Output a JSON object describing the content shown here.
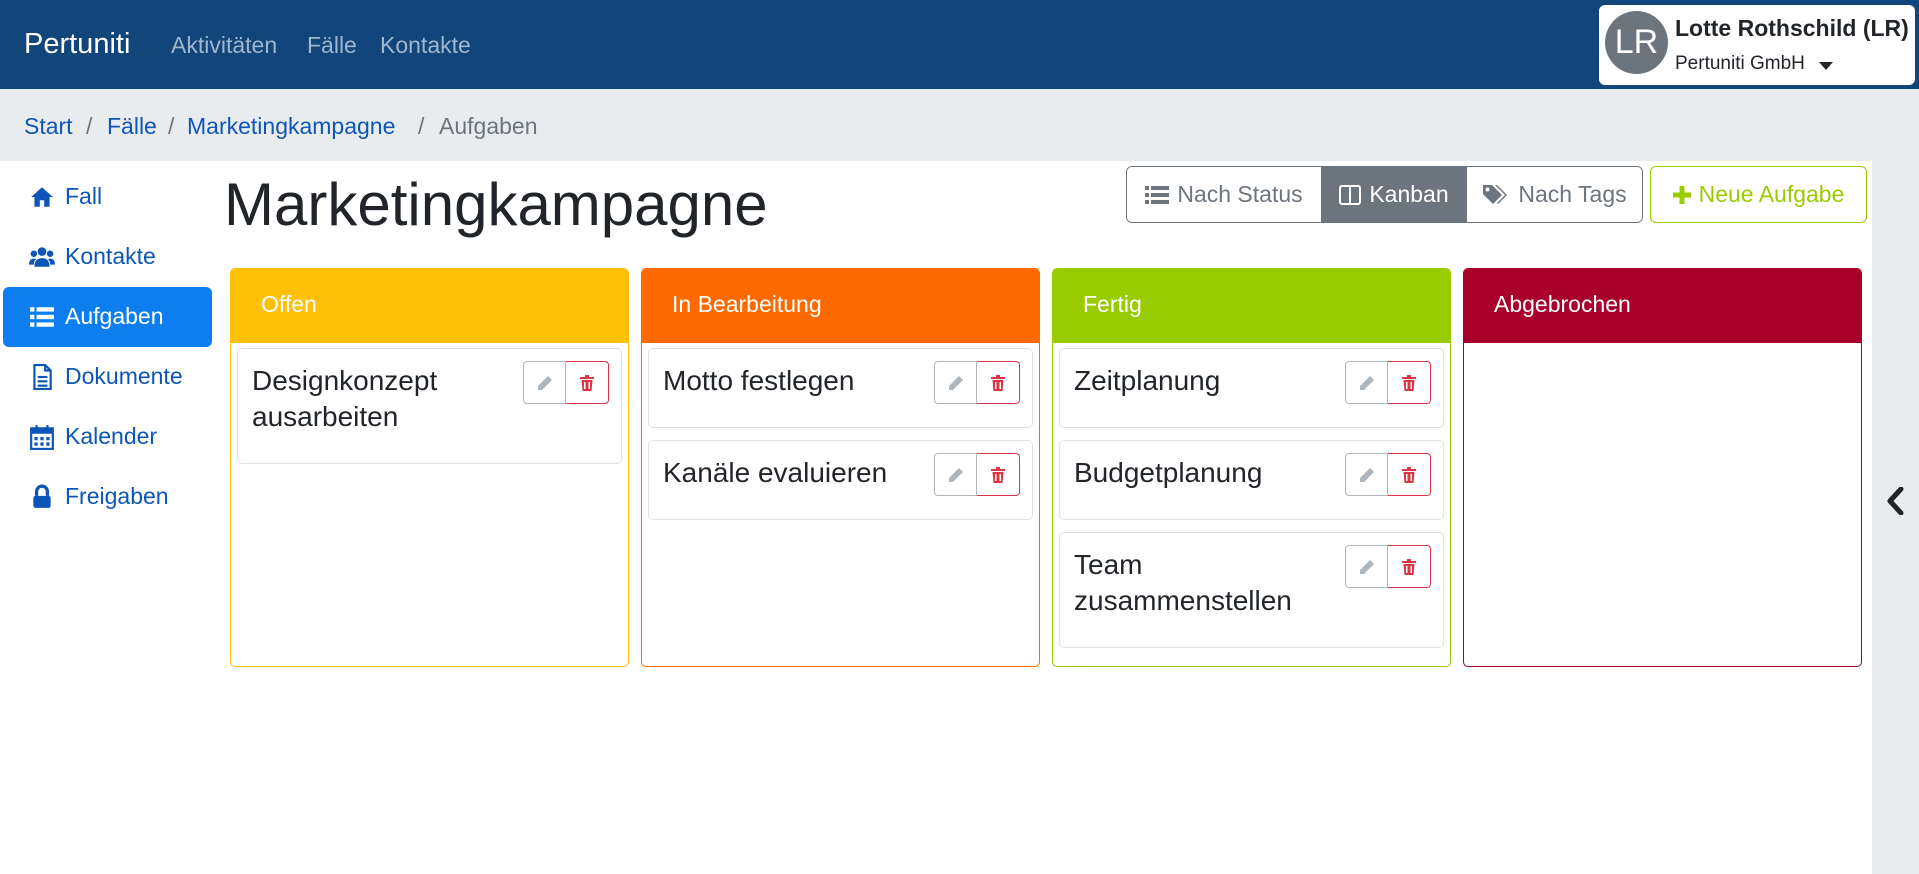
{
  "app": {
    "brand": "Pertuniti"
  },
  "nav": {
    "items": [
      "Aktivitäten",
      "Fälle",
      "Kontakte"
    ]
  },
  "user": {
    "initials": "LR",
    "name": "Lotte Rothschild (LR)",
    "company": "Pertuniti GmbH"
  },
  "breadcrumb": {
    "items": [
      "Start",
      "Fälle",
      "Marketingkampagne",
      "Aufgaben"
    ],
    "separator": "/"
  },
  "sidebar": {
    "items": [
      {
        "label": "Fall",
        "icon": "home-icon"
      },
      {
        "label": "Kontakte",
        "icon": "users-icon"
      },
      {
        "label": "Aufgaben",
        "icon": "list-icon",
        "active": true
      },
      {
        "label": "Dokumente",
        "icon": "document-icon"
      },
      {
        "label": "Kalender",
        "icon": "calendar-icon"
      },
      {
        "label": "Freigaben",
        "icon": "lock-icon"
      }
    ]
  },
  "page": {
    "title": "Marketingkampagne"
  },
  "view_toggle": {
    "by_status": "Nach Status",
    "kanban": "Kanban",
    "by_tags": "Nach Tags",
    "active": "Kanban"
  },
  "new_task_label": "Neue Aufgabe",
  "colors": {
    "navbar": "#12467a",
    "accent": "#0d7ef0",
    "offen": "#ffc107",
    "in_bearbeitung": "#ff6a00",
    "fertig": "#99cc00",
    "abgebrochen": "#a8002a"
  },
  "columns": [
    {
      "title": "Offen",
      "cards": [
        "Designkonzept ausarbeiten"
      ]
    },
    {
      "title": "In Bearbeitung",
      "cards": [
        "Motto festlegen",
        "Kanäle evaluieren"
      ]
    },
    {
      "title": "Fertig",
      "cards": [
        "Zeitplanung",
        "Budgetplanung",
        "Team zusammenstellen"
      ]
    },
    {
      "title": "Abgebrochen",
      "cards": []
    }
  ]
}
